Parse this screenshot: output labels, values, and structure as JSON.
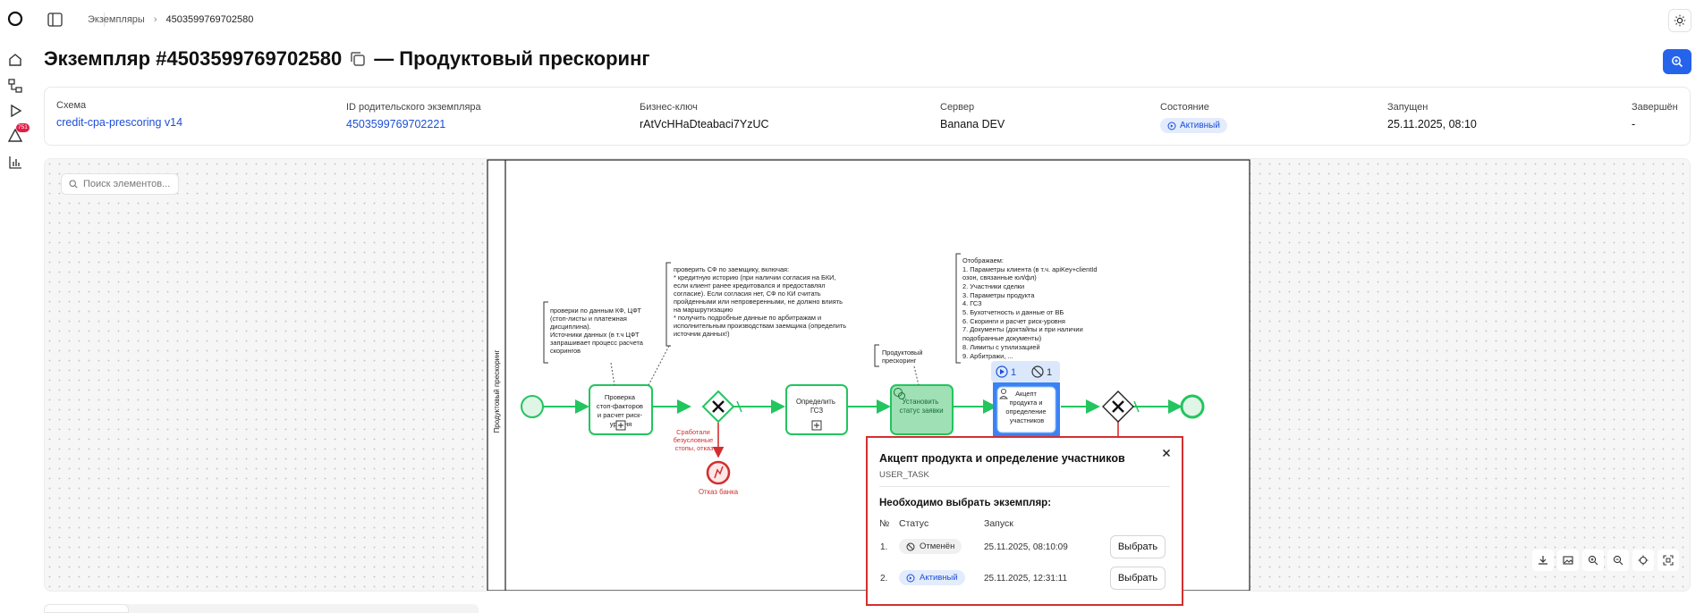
{
  "rail": {
    "items": [
      "logo-icon",
      "home-icon",
      "diagram-icon",
      "play-icon",
      "alert-icon",
      "chart-icon"
    ],
    "alert_count": "751"
  },
  "breadcrumb": {
    "parent": "Экземпляры",
    "current": "4503599769702580"
  },
  "page": {
    "title_prefix": "Экземпляр #4503599769702580",
    "title_suffix": "— Продуктовый прескоринг"
  },
  "meta": {
    "schema_label": "Схема",
    "schema_value": "credit-cpa-prescoring v14",
    "parent_label": "ID родительского экземпляра",
    "parent_value": "4503599769702221",
    "bkey_label": "Бизнес-ключ",
    "bkey_value": "rAtVcHHaDteabaci7YzUC",
    "server_label": "Сервер",
    "server_value": "Banana DEV",
    "state_label": "Состояние",
    "state_value": "Активный",
    "started_label": "Запущен",
    "started_value": "25.11.2025, 08:10",
    "finished_label": "Завершён",
    "finished_value": "-"
  },
  "search": {
    "placeholder": "Поиск элементов..."
  },
  "diagram": {
    "pool_label": "Продуктовый прескоринг",
    "task1": [
      "Проверка",
      "стоп-факторов",
      "и расчет риск-",
      "уровня"
    ],
    "task2": [
      "Определить",
      "ГСЗ"
    ],
    "task3": [
      "Установить",
      "статус заявки"
    ],
    "task4": [
      "Акцепт",
      "продукта и",
      "определение",
      "участников"
    ],
    "red_flow": [
      "Сработали",
      "безусловные",
      "стопы, отказ"
    ],
    "end_error": "Отказ банка",
    "badge_active_count": "1",
    "badge_cancel_count": "1",
    "note1": [
      "проверки по данным КФ, ЦФТ",
      "(стоп-листы и платежная",
      "дисциплина).",
      "Источники данных (в т.ч ЦФТ",
      "запрашивает процесс расчета",
      "скорингов"
    ],
    "note2": [
      "проверить СФ по заемщику, включая:",
      "* кредитную историю (при наличии согласия на БКИ,",
      "если клиент ранее кредитовался и предоставлял",
      "согласие). Если согласия нет, СФ по КИ считать",
      "пройденными или непроверенными, не должно влиять",
      "на маршрутизацию",
      "* получить подробные данные по арбитражам и",
      "исполнительным производствам заемщика (определить",
      "источник данных!)"
    ],
    "note3": [
      "Продуктовый",
      "прескоринг"
    ],
    "note4": [
      "Отображаем:",
      "1. Параметры клиента (в т.ч. apiKey+clientId",
      "озон, связанные юл/фл)",
      "2. Участники сделки",
      "3. Параметры продукта",
      "4. ГСЗ",
      "5. Бухотчетность и данные от ВБ",
      "6. Скоринги и расчет риск-уровня",
      "7. Документы (доктайпы и при наличии",
      "подобранные документы)",
      "8. Лимиты с утилизацией",
      "9. Арбитражи, ..."
    ]
  },
  "popup": {
    "title": "Акцепт продукта и определение участников",
    "type": "USER_TASK",
    "question": "Необходимо выбрать экземпляр:",
    "col_num": "№",
    "col_status": "Статус",
    "col_start": "Запуск",
    "rows": [
      {
        "num": "1.",
        "status": "Отменён",
        "date": "25.11.2025, 08:10:09",
        "action": "Выбрать"
      },
      {
        "num": "2.",
        "status": "Активный",
        "date": "25.11.2025, 12:31:11",
        "action": "Выбрать"
      }
    ]
  },
  "tools": [
    "download-icon",
    "image-icon",
    "zoom-in-icon",
    "zoom-out-icon",
    "center-icon",
    "fit-icon"
  ],
  "colors": {
    "accent": "#2563eb",
    "green": "#22c55e",
    "red": "#d32f2f"
  }
}
